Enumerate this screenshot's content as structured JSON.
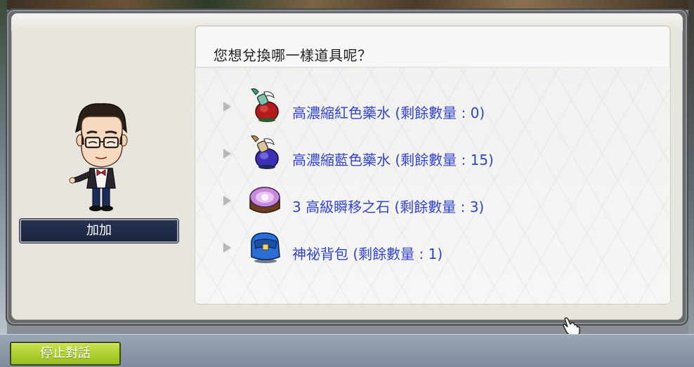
{
  "npc": {
    "name": "加加"
  },
  "dialog": {
    "question": "您想兌換哪一樣道具呢？",
    "options": [
      {
        "icon": "red-potion-icon",
        "label": "高濃縮紅色藥水 (剩餘數量 : 0)"
      },
      {
        "icon": "blue-potion-icon",
        "label": "高濃縮藍色藥水 (剩餘數量 : 15)"
      },
      {
        "icon": "teleport-stone-icon",
        "label": "3 高級瞬移之石 (剩餘數量 : 3)"
      },
      {
        "icon": "mystery-bag-icon",
        "label": "神祕背包 (剩餘數量 : 1)"
      }
    ]
  },
  "bottom_bar": {
    "stop_label": "停止對話"
  },
  "colors": {
    "option_text": "#3344cc",
    "name_plate": "#1a2540",
    "stop_button": "#b5d335"
  }
}
